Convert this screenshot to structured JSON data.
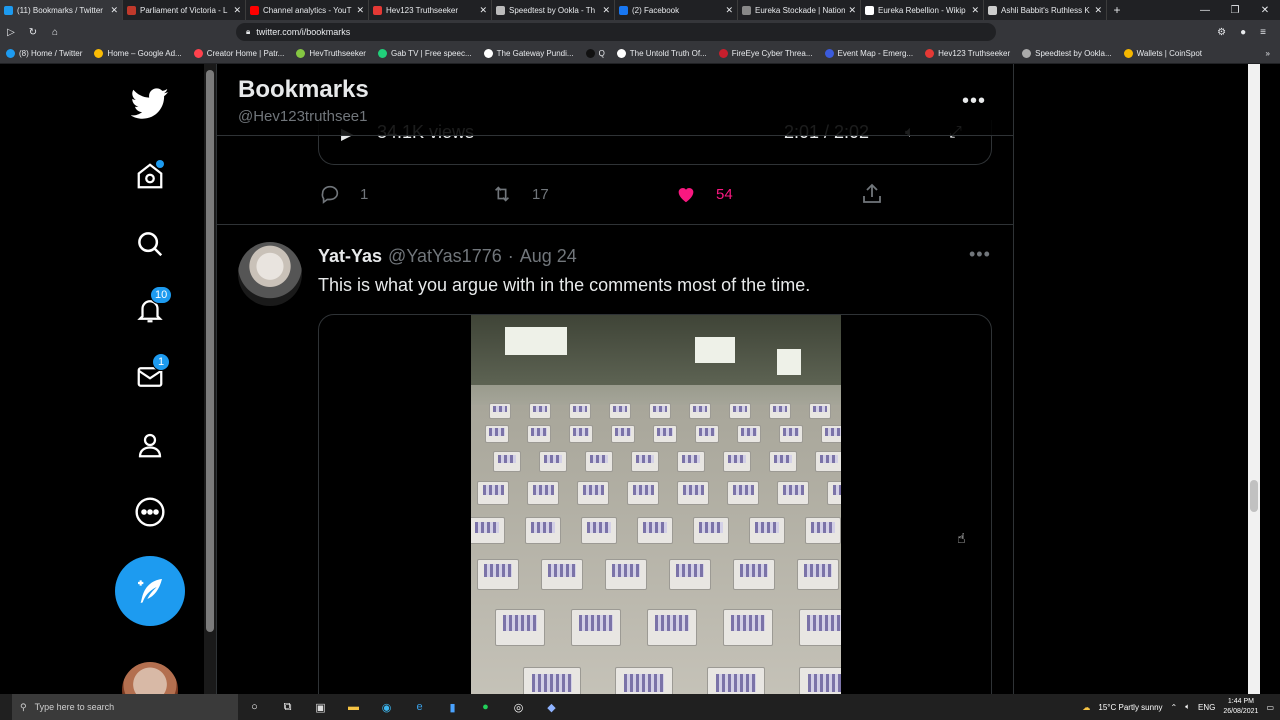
{
  "browser": {
    "tabs": [
      {
        "label": "(11) Bookmarks / Twitter",
        "icon": "twitter-icon",
        "color": "#1d9bf0",
        "active": true
      },
      {
        "label": "Parliament of Victoria - L",
        "icon": "parliament-icon",
        "color": "#c0392b"
      },
      {
        "label": "Channel analytics - YouT",
        "icon": "youtube-icon",
        "color": "#ff0000"
      },
      {
        "label": "Hev123 Truthseeker",
        "icon": "rumble-icon",
        "color": "#e53935"
      },
      {
        "label": "Speedtest by Ookla - Th",
        "icon": "speedtest-icon",
        "color": "#bbbbbb"
      },
      {
        "label": "(2) Facebook",
        "icon": "facebook-icon",
        "color": "#1877f2"
      },
      {
        "label": "Eureka Stockade | Nation",
        "icon": "page-icon",
        "color": "#888888"
      },
      {
        "label": "Eureka Rebellion - Wikip",
        "icon": "wikipedia-icon",
        "color": "#ffffff"
      },
      {
        "label": "Ashli Babbit's Ruthless K",
        "icon": "gp-icon",
        "color": "#cccccc"
      }
    ],
    "new_tab": "+",
    "window_controls": [
      "—",
      "❐",
      "✕"
    ],
    "url": "twitter.com/i/bookmarks",
    "bookmarks": [
      {
        "label": "(8) Home / Twitter",
        "color": "#1d9bf0"
      },
      {
        "label": "Home – Google Ad...",
        "color": "#fbbc04"
      },
      {
        "label": "Creator Home | Patr...",
        "color": "#ff424d"
      },
      {
        "label": "HevTruthseeker",
        "color": "#85c742"
      },
      {
        "label": "Gab TV | Free speec...",
        "color": "#21cf7a"
      },
      {
        "label": "The Gateway Pundi...",
        "color": "#ffffff"
      },
      {
        "label": "Q",
        "color": "#111111"
      },
      {
        "label": "The Untold Truth Of...",
        "color": "#ffffff"
      },
      {
        "label": "FireEye Cyber Threa...",
        "color": "#c81f2d"
      },
      {
        "label": "Event Map - Emerg...",
        "color": "#3b5bdb"
      },
      {
        "label": "Hev123 Truthseeker",
        "color": "#e53935"
      },
      {
        "label": "Speedtest by Ookla...",
        "color": "#aaaaaa"
      },
      {
        "label": "Wallets | CoinSpot",
        "color": "#f5b700"
      }
    ]
  },
  "sidebar": {
    "notifications_badge": "10",
    "messages_badge": "1"
  },
  "header": {
    "title": "Bookmarks",
    "handle": "@Hev123truthsee1",
    "more": "•••"
  },
  "prev_tweet": {
    "views": "34.1K views",
    "time": "2:01 / 2:02",
    "replies": "1",
    "retweets": "17",
    "likes": "54"
  },
  "tweet": {
    "name": "Yat-Yas",
    "handle": "@YatYas1776",
    "dot": "·",
    "date": "Aug 24",
    "text": "This is what you argue with in the comments most of the time.",
    "more": "•••"
  },
  "taskbar": {
    "search_placeholder": "Type here to search",
    "weather": "15°C  Partly sunny",
    "lang": "ENG",
    "time": "1:44 PM",
    "date": "26/08/2021"
  },
  "colors": {
    "accent": "#1d9bf0",
    "like": "#f91880"
  }
}
